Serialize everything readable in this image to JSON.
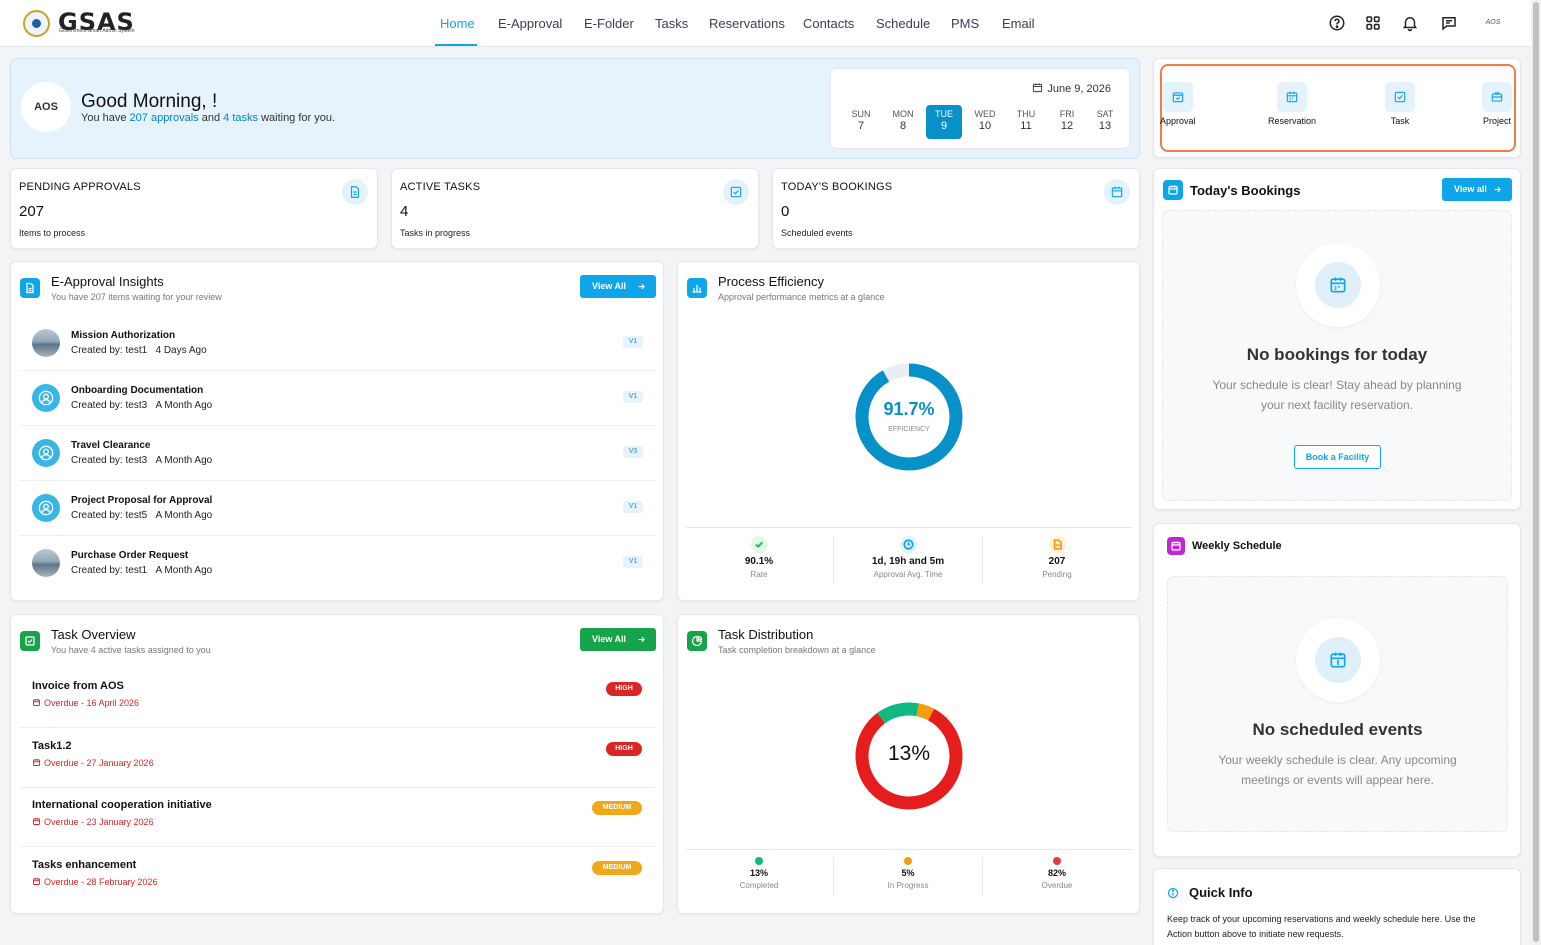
{
  "header": {
    "logo_text": "GSAS",
    "logo_subtitle": "Government Smart Admin System",
    "nav": [
      "Home",
      "E-Approval",
      "E-Folder",
      "Tasks",
      "Reservations",
      "Contacts",
      "Schedule",
      "PMS",
      "Email"
    ],
    "user_initials": "AOS"
  },
  "greeting": {
    "org_logo": "AOS",
    "title": "Good Morning, !",
    "prefix": "You have",
    "approvals": "207 approvals",
    "and": "and",
    "tasks": "4 tasks",
    "suffix": "waiting for you.",
    "date": "June 9, 2026",
    "days": [
      {
        "name": "SUN",
        "num": "7"
      },
      {
        "name": "MON",
        "num": "8"
      },
      {
        "name": "TUE",
        "num": "9"
      },
      {
        "name": "WED",
        "num": "10"
      },
      {
        "name": "THU",
        "num": "11"
      },
      {
        "name": "FRI",
        "num": "12"
      },
      {
        "name": "SAT",
        "num": "13"
      }
    ],
    "active_day": "TUE"
  },
  "stats": [
    {
      "label": "PENDING APPROVALS",
      "value": "207",
      "sub": "Items to process",
      "icon": "document-icon"
    },
    {
      "label": "ACTIVE TASKS",
      "value": "4",
      "sub": "Tasks in progress",
      "icon": "check-square-icon"
    },
    {
      "label": "TODAY'S BOOKINGS",
      "value": "0",
      "sub": "Scheduled events",
      "icon": "calendar-icon"
    }
  ],
  "approvals": {
    "title": "E-Approval Insights",
    "subtitle": "You have 207 items waiting for your review",
    "view_all": "View All",
    "items": [
      {
        "title": "Mission Authorization",
        "by": "Created by: test1",
        "time": "4 Days Ago",
        "version": "V1",
        "avatar": "photo"
      },
      {
        "title": "Onboarding Documentation",
        "by": "Created by: test3",
        "time": "A Month Ago",
        "version": "V1",
        "avatar": "user"
      },
      {
        "title": "Travel Clearance",
        "by": "Created by: test3",
        "time": "A Month Ago",
        "version": "V3",
        "avatar": "user"
      },
      {
        "title": "Project Proposal for Approval",
        "by": "Created by: test5",
        "time": "A Month Ago",
        "version": "V1",
        "avatar": "user"
      },
      {
        "title": "Purchase Order Request",
        "by": "Created by: test1",
        "time": "A Month Ago",
        "version": "V1",
        "avatar": "photo"
      }
    ]
  },
  "efficiency": {
    "title": "Process Efficiency",
    "subtitle": "Approval performance metrics at a glance",
    "percent": 91.7,
    "value_label": "91.7%",
    "center_label": "EFFICIENCY",
    "metrics": [
      {
        "value": "90.1%",
        "label": "Rate",
        "color": "#22c55e"
      },
      {
        "value": "1d, 19h and 5m",
        "label": "Approval Avg. Time",
        "color": "#0ea5e9"
      },
      {
        "value": "207",
        "label": "Pending",
        "color": "#f59e0b"
      }
    ]
  },
  "tasks": {
    "title": "Task Overview",
    "subtitle": "You have 4 active tasks assigned to you",
    "view_all": "View All",
    "items": [
      {
        "title": "Invoice from AOS",
        "due": "Overdue - 16 April 2026",
        "priority": "HIGH"
      },
      {
        "title": "Task1.2",
        "due": "Overdue - 27 January 2026",
        "priority": "HIGH"
      },
      {
        "title": "International cooperation initiative",
        "due": "Overdue - 23 January 2026",
        "priority": "MEDIUM"
      },
      {
        "title": "Tasks enhancement",
        "due": "Overdue - 28 February 2026",
        "priority": "MEDIUM"
      }
    ]
  },
  "distribution": {
    "title": "Task Distribution",
    "subtitle": "Task completion breakdown at a glance",
    "center_label": "13%",
    "segments": [
      {
        "value": "13%",
        "label": "Completed",
        "pct": 13,
        "color": "#10b981"
      },
      {
        "value": "5%",
        "label": "In Progress",
        "pct": 5,
        "color": "#f59e0b"
      },
      {
        "value": "82%",
        "label": "Overdue",
        "pct": 82,
        "color": "#e51d1d"
      }
    ]
  },
  "quick_actions": [
    {
      "label": "Approval",
      "icon": "approval-icon"
    },
    {
      "label": "Reservation",
      "icon": "calendar-icon"
    },
    {
      "label": "Task",
      "icon": "check-square-icon"
    },
    {
      "label": "Project",
      "icon": "briefcase-icon"
    }
  ],
  "bookings": {
    "title": "Today's Bookings",
    "view_all": "View all",
    "empty_title": "No bookings for today",
    "empty_line1": "Your schedule is clear! Stay ahead by planning",
    "empty_line2": "your next facility reservation.",
    "button": "Book a Facility"
  },
  "weekly": {
    "title": "Weekly Schedule",
    "empty_title": "No scheduled events",
    "empty_line1": "Your weekly schedule is clear. Any upcoming",
    "empty_line2": "meetings or events will appear here."
  },
  "quick_info": {
    "title": "Quick Info",
    "line1": "Keep track of your upcoming reservations and weekly schedule here. Use the",
    "line2": "Action button above to initiate new requests."
  },
  "colors": {
    "accent": "#0ea5e9",
    "success": "#16a34a",
    "danger": "#dc2626",
    "warning": "#f0a81b",
    "highlight": "#f07c4a"
  }
}
